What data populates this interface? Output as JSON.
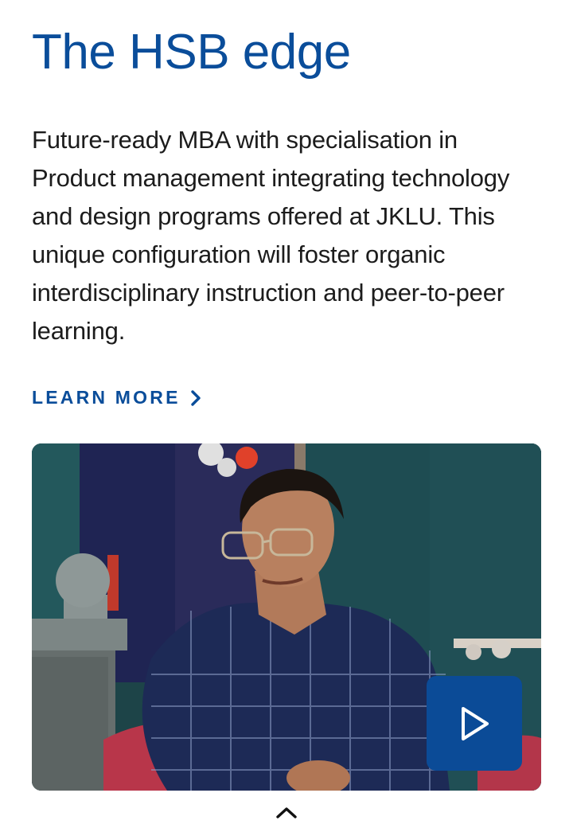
{
  "section": {
    "title": "The HSB edge",
    "description": "Future-ready MBA with specialisation in Product management integrating technology and design programs offered at JKLU.  This unique configuration will foster organic interdisciplinary instruction and peer-to-peer learning.",
    "learn_more_label": "LEARN MORE",
    "learn_more_icon": "chevron-right-icon"
  },
  "media": {
    "image_alt": "Student seated in a chair, portrait",
    "play_icon": "play-icon"
  },
  "navigation": {
    "scroll_top_icon": "chevron-up-icon"
  },
  "colors": {
    "brand": "#0a4d9a",
    "play_button": "#0b4b97",
    "text": "#1c1c1c"
  }
}
